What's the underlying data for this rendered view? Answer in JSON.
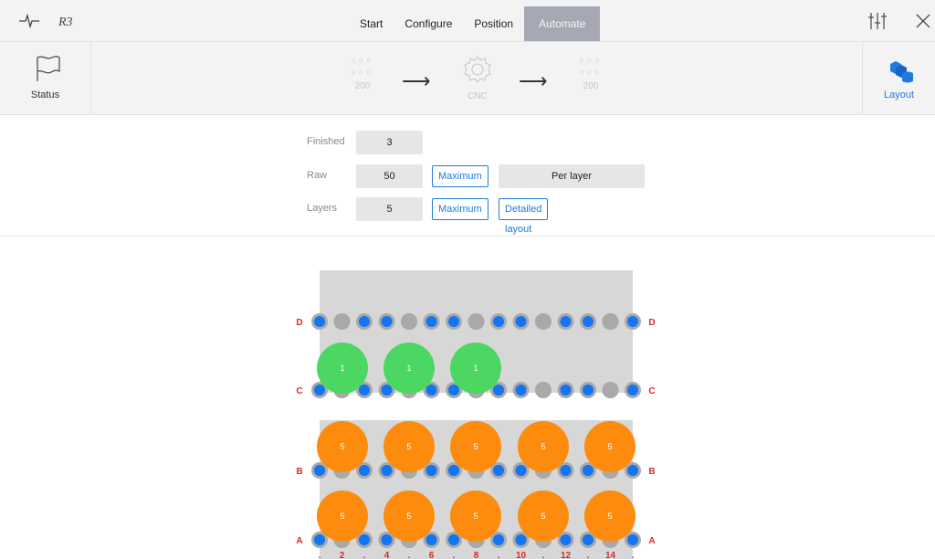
{
  "topbar": {
    "tabs": [
      "Start",
      "Configure",
      "Position",
      "Automate"
    ],
    "active_tab": "Automate"
  },
  "workflow": {
    "status_label": "Status",
    "input_count": "200",
    "machine_label": "CNC",
    "output_count": "200",
    "layout_label": "Layout"
  },
  "form": {
    "finished": {
      "label": "Finished",
      "value": "3"
    },
    "raw": {
      "label": "Raw",
      "value": "50",
      "max_label": "Maximum",
      "per_layer_label": "Per layer"
    },
    "layers": {
      "label": "Layers",
      "value": "5",
      "max_label": "Maximum",
      "detailed_label": "Detailed layout"
    }
  },
  "grid": {
    "rows": [
      "D",
      "C",
      "B",
      "A"
    ],
    "col_labels": [
      ".",
      "2",
      ".",
      "4",
      ".",
      "6",
      ".",
      "8",
      ".",
      "10",
      ".",
      "12",
      ".",
      "14",
      "."
    ],
    "pin_pattern": {
      "D": [
        "blue",
        "gray",
        "blue",
        "blue",
        "gray",
        "blue",
        "blue",
        "gray",
        "blue",
        "blue",
        "gray",
        "blue",
        "blue",
        "gray",
        "blue"
      ],
      "C": [
        "blue",
        "gray",
        "blue",
        "blue",
        "gray",
        "blue",
        "blue",
        "gray",
        "blue",
        "blue",
        "gray",
        "blue",
        "blue",
        "gray",
        "blue"
      ],
      "B": [
        "blue",
        "gray",
        "blue",
        "blue",
        "gray",
        "blue",
        "blue",
        "gray",
        "blue",
        "blue",
        "gray",
        "blue",
        "blue",
        "gray",
        "blue"
      ],
      "A": [
        "blue",
        "gray",
        "blue",
        "blue",
        "gray",
        "blue",
        "blue",
        "gray",
        "blue",
        "blue",
        "gray",
        "blue",
        "blue",
        "gray",
        "blue"
      ]
    },
    "finished_parts": {
      "color": "#4cd763",
      "label": "1",
      "count": 3
    },
    "raw_parts": {
      "color": "#fd8c0e",
      "label": "5",
      "per_row": 5
    },
    "colors": {
      "pin_blue": "#1575f0",
      "pin_gray": "#a9a9a9",
      "row_label": "#e0242f",
      "plate": "#d7d7d7"
    }
  }
}
